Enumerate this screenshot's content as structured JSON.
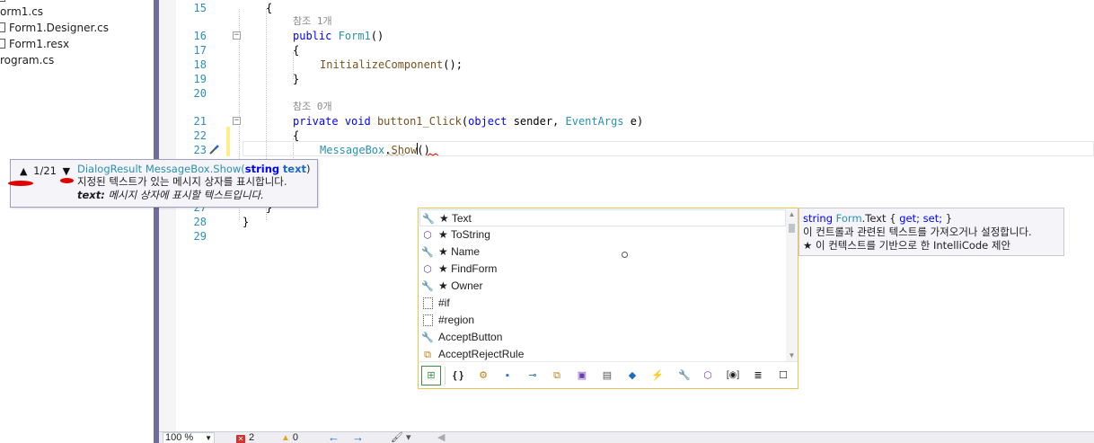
{
  "solution_explorer": {
    "items": [
      "orm1.cs",
      "Form1.Designer.cs",
      "Form1.resx",
      "rogram.cs"
    ]
  },
  "editor": {
    "lines": [
      {
        "n": "15",
        "code": "{"
      },
      {
        "n": "16",
        "code": "public Form1()"
      },
      {
        "n": "17",
        "code": "{"
      },
      {
        "n": "18",
        "code": "InitializeComponent();"
      },
      {
        "n": "19",
        "code": "}"
      },
      {
        "n": "20",
        "code": ""
      },
      {
        "n": "21",
        "code": "private void button1_Click(object sender, EventArgs e)"
      },
      {
        "n": "22",
        "code": "{"
      },
      {
        "n": "23",
        "code": "MessageBox.Show()"
      },
      {
        "n": "27",
        "code": "}"
      },
      {
        "n": "28",
        "code": "}"
      },
      {
        "n": "29",
        "code": ""
      }
    ],
    "codelens": [
      "참조 1개",
      "참조 0개"
    ],
    "line15": "{",
    "line16_kw": "public",
    "line16_name": "Form1",
    "line16_rest": "()",
    "line17": "{",
    "line18_fn": "InitializeComponent",
    "line18_rest": "();",
    "line19": "}",
    "line21_kw1": "private",
    "line21_kw2": "void",
    "line21_fn": "button1_Click",
    "line21_p1": "(",
    "line21_kw3": "object",
    "line21_p2": " sender, ",
    "line21_ty": "EventArgs",
    "line21_p3": " e)",
    "line22": "{",
    "line23_ty": "MessageBox",
    "line23_dot": ".",
    "line23_fn": "Show",
    "line23_rest": "()",
    "line27": "}",
    "line28": "}"
  },
  "param_info": {
    "counter": "1/21",
    "return_type": "DialogResult",
    "method": "MessageBox.Show(",
    "param_type": "string",
    "param_name": "text",
    "close": ")",
    "description": "지정된 텍스트가 있는 메시지 상자를 표시합니다.",
    "param_label": "text:",
    "param_description": "메시지 상자에 표시할 텍스트입니다."
  },
  "completion": {
    "items": [
      {
        "icon": "wrench-icon",
        "label": "★ Text",
        "selected": true
      },
      {
        "icon": "method-cube-icon",
        "label": "★ ToString"
      },
      {
        "icon": "wrench-icon",
        "label": "★ Name"
      },
      {
        "icon": "method-cube-icon",
        "label": "★ FindForm"
      },
      {
        "icon": "wrench-icon",
        "label": "★ Owner"
      },
      {
        "icon": "snippet-icon",
        "label": "#if"
      },
      {
        "icon": "snippet-icon",
        "label": "#region"
      },
      {
        "icon": "wrench-icon",
        "label": "AcceptButton"
      },
      {
        "icon": "event-icon",
        "label": "AcceptRejectRule"
      }
    ],
    "filters": [
      "{ }",
      "⚙",
      "▪",
      "⊸",
      "⧉",
      "▣",
      "▤",
      "◆",
      "⚡",
      "🔧",
      "⬡",
      "[◉]",
      "≣",
      "☐"
    ]
  },
  "quick_info": {
    "type": "string",
    "member": "Form",
    "member_rest": ".Text {",
    "get": "get;",
    "set": "set;",
    "close": "}",
    "description": "이 컨트롤과 관련된 텍스트를 가져오거나 설정합니다.",
    "intellicode": "★  이 컨텍스트를 기반으로 한 IntelliCode 제안"
  },
  "statusbar": {
    "zoom": "100 %",
    "errors": "2",
    "warnings": "0"
  },
  "colors": {
    "keyword": "#0000ff",
    "type": "#2b91af",
    "method": "#74531f",
    "completion_border": "#e8c650"
  }
}
